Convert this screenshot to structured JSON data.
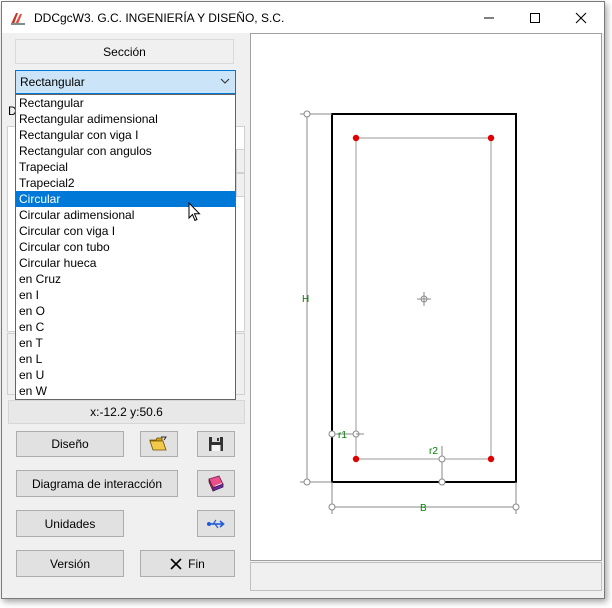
{
  "window": {
    "title": "DDCgcW3. G.C. INGENIERÍA Y DISEÑO, S.C.",
    "minimize_glyph": "—",
    "maximize_glyph": "☐",
    "close_glyph": "✕"
  },
  "section": {
    "header": "Sección",
    "selected": "Rectangular"
  },
  "dropdown": {
    "items": [
      "Rectangular",
      "Rectangular adimensional",
      "Rectangular con viga I",
      "Rectangular con angulos",
      "Trapecial",
      "Trapecial2",
      "Circular",
      "Circular adimensional",
      "Circular con viga I",
      "Circular con tubo",
      "Circular hueca",
      "en Cruz",
      "en I",
      "en O",
      "en C",
      "en T",
      "en L",
      "en U",
      "en W"
    ],
    "highlighted": "Circular"
  },
  "hidden_label_fragment": "D",
  "coords": "x:-12.2 y:50.6",
  "buttons": {
    "diseno": "Diseño",
    "diagrama": "Diagrama de interacción",
    "unidades": "Unidades",
    "version": "Versión",
    "fin": "Fin"
  },
  "icons": {
    "app": "ddc-app-icon",
    "open": "open-folder-icon",
    "save": "floppy-save-icon",
    "book": "book-icon",
    "units": "usb-arrows-icon",
    "fin": "x-close-icon",
    "cursor": "mouse-pointer-icon"
  },
  "drawing": {
    "label_h": "H",
    "label_b": "B",
    "label_r1": "r1",
    "label_r2": "r2"
  },
  "colors": {
    "selection": "#0078d7",
    "combo_bg": "#cce4f7",
    "rebar": "#e00000",
    "dimension_text": "#008000",
    "outline": "#000000"
  }
}
